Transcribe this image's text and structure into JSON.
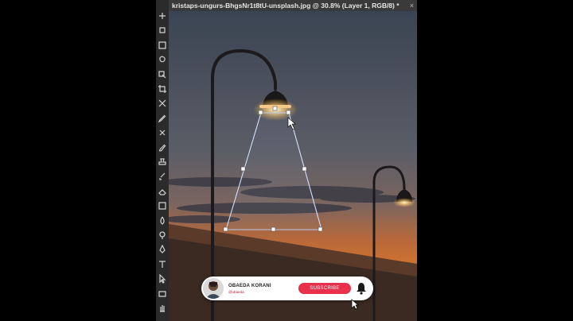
{
  "document": {
    "tab_title": "kristaps-ungurs-BhgsNr1t8tU-unsplash.jpg @ 30.8% (Layer 1, RGB/8) *",
    "tab_close": "×"
  },
  "toolbar": {
    "tools": [
      "move-icon",
      "artboard-icon",
      "marquee-icon",
      "lasso-icon",
      "object-select-icon",
      "crop-icon",
      "frame-icon",
      "eyedropper-icon",
      "spot-heal-icon",
      "brush-icon",
      "clone-stamp-icon",
      "history-brush-icon",
      "eraser-icon",
      "gradient-icon",
      "blur-icon",
      "dodge-icon",
      "pen-icon",
      "type-icon",
      "path-select-icon",
      "rectangle-icon",
      "hand-icon"
    ]
  },
  "overlay": {
    "channel_name": "OBAEDA KORANI",
    "channel_handle": "@obaeda",
    "subscribe_label": "SUBSCRIBE"
  },
  "colors": {
    "sky_top": "#3a4452",
    "sky_mid": "#5a5a62",
    "sunset": "#e07a35",
    "lamp_glow": "#fff3c8",
    "subscribe": "#e8304a",
    "ui_panel": "#2b2b2b"
  }
}
